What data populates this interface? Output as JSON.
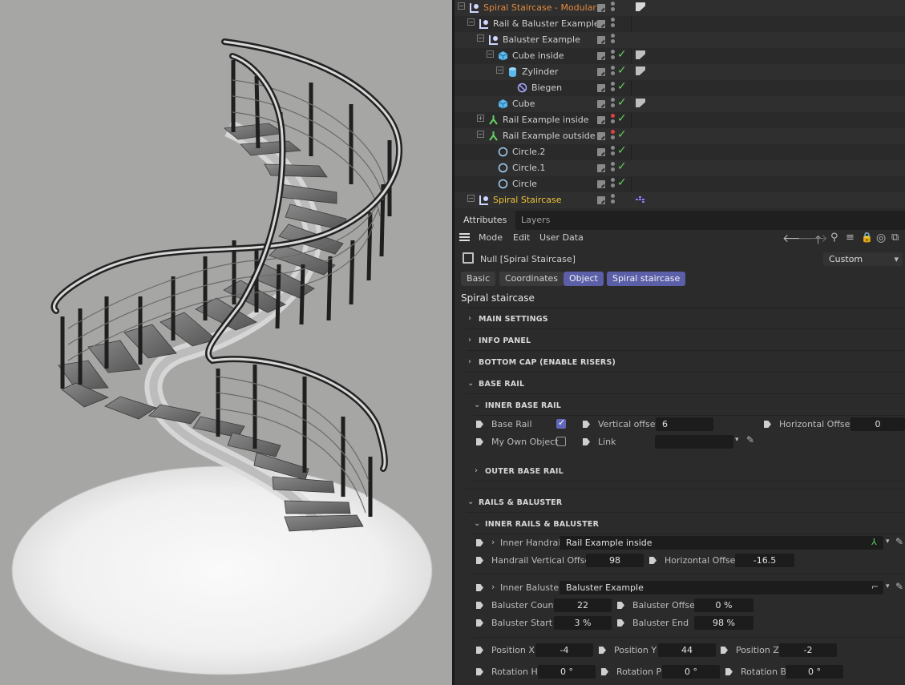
{
  "object_manager": {
    "rows": [
      {
        "label": "Spiral Staircase - Modular",
        "indent": 0,
        "style": "orange",
        "icon": "null-icon",
        "tree": "minus",
        "check": false,
        "tag": "note-tag",
        "dots": [
          "grey",
          "grey"
        ]
      },
      {
        "label": "Rail & Baluster Example",
        "indent": 1,
        "style": "normal",
        "icon": "null-icon",
        "tree": "minus",
        "check": false,
        "tag": "",
        "dots": [
          "grey",
          "grey"
        ]
      },
      {
        "label": "Baluster Example",
        "indent": 2,
        "style": "normal",
        "icon": "null-icon",
        "tree": "minus",
        "check": false,
        "tag": "",
        "dots": [
          "grey",
          "grey"
        ]
      },
      {
        "label": "Cube inside",
        "indent": 3,
        "style": "normal",
        "icon": "cube-icon",
        "tree": "minus",
        "check": true,
        "tag": "phong-tag",
        "dots": [
          "grey",
          "grey"
        ]
      },
      {
        "label": "Zylinder",
        "indent": 4,
        "style": "normal",
        "icon": "cylinder-icon",
        "tree": "minus",
        "check": true,
        "tag": "phong-tag",
        "dots": [
          "grey",
          "grey"
        ]
      },
      {
        "label": "Biegen",
        "indent": 5,
        "style": "normal",
        "icon": "bend-icon",
        "tree": "",
        "check": true,
        "tag": "",
        "dots": [
          "grey",
          "grey"
        ]
      },
      {
        "label": "Cube",
        "indent": 3,
        "style": "normal",
        "icon": "cube-icon",
        "tree": "",
        "check": true,
        "tag": "phong-tag",
        "dots": [
          "grey",
          "grey"
        ]
      },
      {
        "label": "Rail Example inside",
        "indent": 2,
        "style": "normal",
        "icon": "spline-icon",
        "tree": "plus",
        "check": true,
        "tag": "",
        "dots": [
          "red",
          "grey"
        ]
      },
      {
        "label": "Rail Example outside",
        "indent": 2,
        "style": "normal",
        "icon": "spline-icon",
        "tree": "minus",
        "check": true,
        "tag": "",
        "dots": [
          "red",
          "grey"
        ]
      },
      {
        "label": "Circle.2",
        "indent": 3,
        "style": "normal",
        "icon": "circle-icon",
        "tree": "",
        "check": true,
        "tag": "",
        "dots": [
          "grey",
          "grey"
        ]
      },
      {
        "label": "Circle.1",
        "indent": 3,
        "style": "normal",
        "icon": "circle-icon",
        "tree": "",
        "check": true,
        "tag": "",
        "dots": [
          "grey",
          "grey"
        ]
      },
      {
        "label": "Circle",
        "indent": 3,
        "style": "normal",
        "icon": "circle-icon",
        "tree": "",
        "check": true,
        "tag": "",
        "dots": [
          "grey",
          "grey"
        ]
      },
      {
        "label": "Spiral Staircase",
        "indent": 1,
        "style": "yellow",
        "icon": "null-icon",
        "tree": "minus",
        "check": false,
        "tag": "python-tag",
        "dots": [
          "grey",
          "grey"
        ]
      }
    ]
  },
  "tabs": [
    "Attributes",
    "Layers"
  ],
  "menu": [
    "Mode",
    "Edit",
    "User Data"
  ],
  "object_header": {
    "title": "Null [Spiral Staircase]",
    "preset": "Custom"
  },
  "prop_tabs": [
    {
      "label": "Basic",
      "selected": false
    },
    {
      "label": "Coordinates",
      "selected": false
    },
    {
      "label": "Object",
      "selected": true
    },
    {
      "label": "Spiral staircase",
      "selected": true
    }
  ],
  "section_title": "Spiral staircase",
  "groups": {
    "main_settings": "MAIN SETTINGS",
    "info_panel": "INFO PANEL",
    "bottom_cap": "BOTTOM CAP (ENABLE RISERS)",
    "base_rail": "BASE RAIL",
    "inner_base_rail": "INNER BASE RAIL",
    "outer_base_rail": "OUTER BASE RAIL",
    "rails_baluster": "RAILS & BALUSTER",
    "inner_rails_baluster": "INNER RAILS & BALUSTER"
  },
  "base_rail": {
    "base_rail_label": "Base Rail",
    "base_rail_checked": true,
    "vertical_offset_label": "Vertical offset",
    "vertical_offset": "6",
    "horizontal_offset_label": "Horizontal Offset",
    "horizontal_offset": "0",
    "my_own_object_label": "My Own Object",
    "my_own_object_checked": false,
    "link_label": "Link",
    "link_value": ""
  },
  "inner_rails": {
    "inner_handrail_label": "Inner Handrail",
    "inner_handrail_value": "Rail Example inside",
    "handrail_vertical_offset_label": "Handrail Vertical Offset",
    "handrail_vertical_offset": "98",
    "horizontal_offset_label": "Horizontal Offset",
    "horizontal_offset": "-16.5",
    "inner_baluster_label": "Inner Baluster",
    "inner_baluster_value": "Baluster Example",
    "baluster_count_label": "Baluster Count",
    "baluster_count": "22",
    "baluster_offset_label": "Baluster Offset",
    "baluster_offset": "0 %",
    "baluster_start_label": "Baluster Start",
    "baluster_start": "3 %",
    "baluster_end_label": "Baluster End",
    "baluster_end": "98 %",
    "position_x_label": "Position X",
    "position_x": "-4",
    "position_y_label": "Position Y",
    "position_y": "44",
    "position_z_label": "Position Z",
    "position_z": "-2",
    "rotation_h_label": "Rotation H",
    "rotation_h": "0 °",
    "rotation_p_label": "Rotation P",
    "rotation_p": "0 °",
    "rotation_b_label": "Rotation B",
    "rotation_b": "0 °"
  },
  "colors": {
    "accent": "#5b5fa8",
    "orange_label": "#e28a40",
    "yellow_label": "#f0c23a",
    "check": "#5fd35f"
  }
}
